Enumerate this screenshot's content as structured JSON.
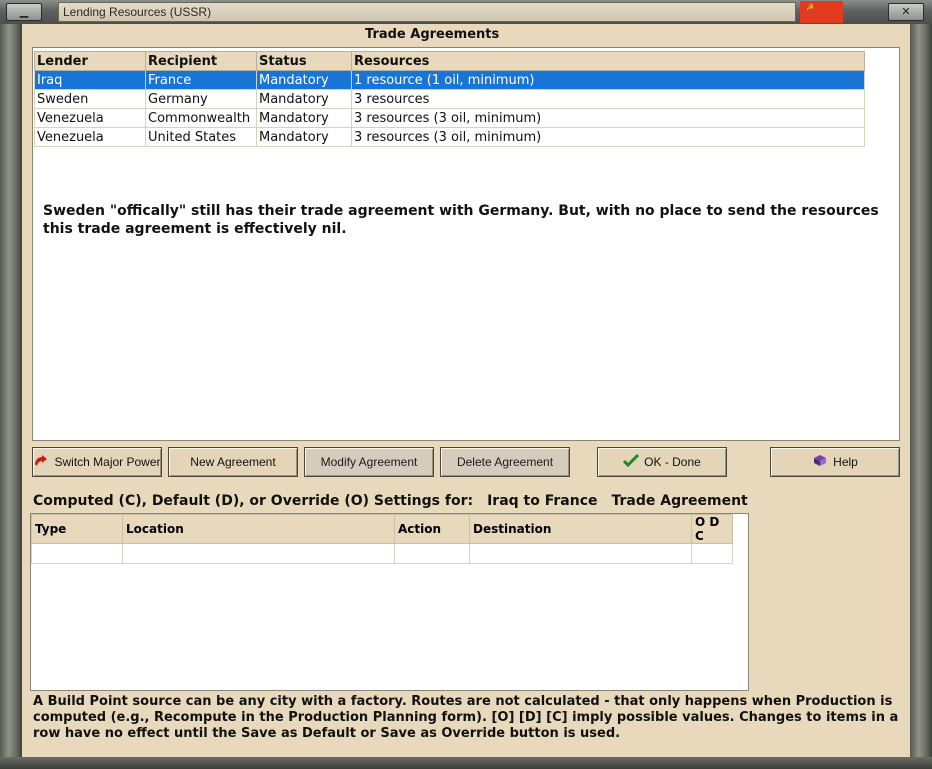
{
  "window": {
    "title": "Lending Resources (USSR)",
    "minimize_glyph": "▁",
    "close_glyph": "✕",
    "flag_glyph": "☭",
    "accent_selected": "#1874d6"
  },
  "trade_agreements": {
    "title": "Trade Agreements",
    "columns": [
      "Lender",
      "Recipient",
      "Status",
      "Resources"
    ],
    "rows": [
      [
        "Iraq",
        "France",
        "Mandatory",
        "1 resource (1 oil, minimum)"
      ],
      [
        "Sweden",
        "Germany",
        "Mandatory",
        "3 resources"
      ],
      [
        "Venezuela",
        "Commonwealth",
        "Mandatory",
        "3 resources (3 oil, minimum)"
      ],
      [
        "Venezuela",
        "United States",
        "Mandatory",
        "3 resources (3 oil, minimum)"
      ]
    ],
    "selected_row": 0,
    "note": "Sweden \"offically\" still has their trade agreement with Germany.  But, with no place to send the resources this trade agreement is effectively nil."
  },
  "buttons": {
    "switch_major_power": "Switch Major Power",
    "new_agreement": "New Agreement",
    "modify_agreement": "Modify Agreement",
    "delete_agreement": "Delete Agreement",
    "ok_done": "OK - Done",
    "help": "Help"
  },
  "settings": {
    "label": "Computed (C), Default (D), or Override (O) Settings for:",
    "for": "Iraq to France",
    "kind": "Trade Agreement",
    "columns": [
      "Type",
      "Location",
      "Action",
      "Destination",
      "O D C"
    ]
  },
  "footer": "A Build Point source can be any city with a factory. Routes are not calculated - that only happens when Production is computed (e.g., Recompute in the Production Planning form).  [O] [D] [C] imply possible values.  Changes to items in a row have no effect until the Save as Default or Save as Override button is used."
}
